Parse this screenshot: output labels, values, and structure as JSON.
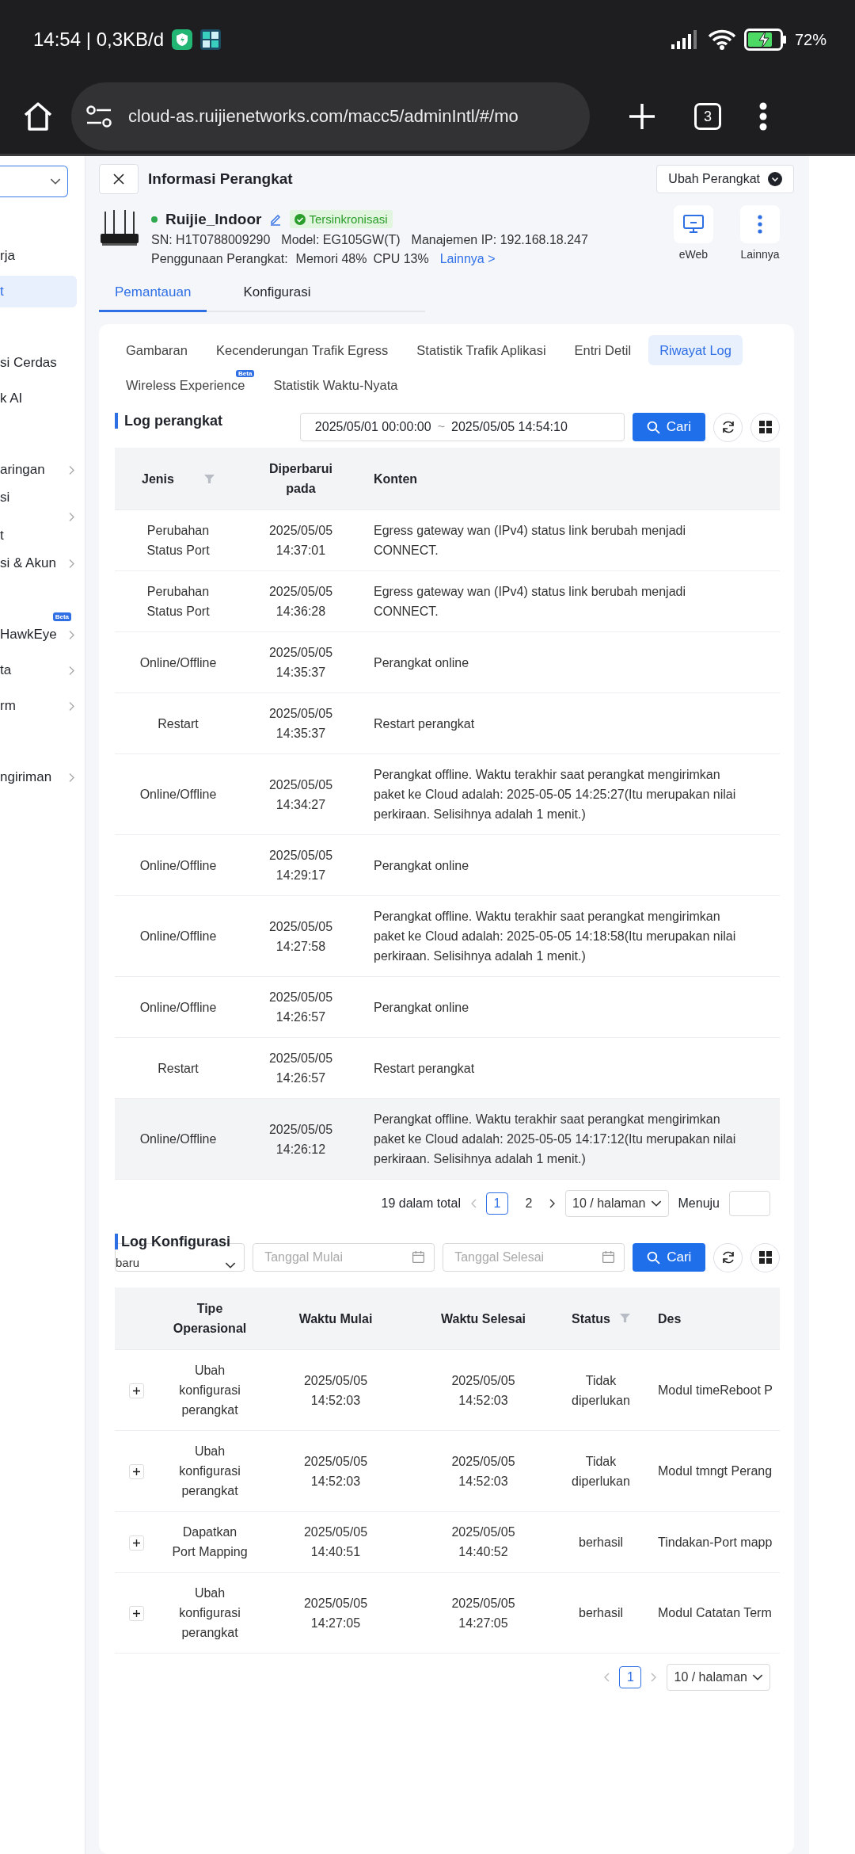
{
  "status_bar": {
    "time_speed": "14:54 | 0,3KB/d",
    "battery": "72%"
  },
  "browser": {
    "url": "cloud-as.ruijienetworks.com/macc5/adminIntl/#/mo",
    "tab_count": "3"
  },
  "sidebar": {
    "groups": [
      [
        {
          "lines": [
            "rja"
          ],
          "selected": false,
          "expandable": false
        },
        {
          "lines": [
            "t"
          ],
          "selected": true,
          "expandable": false
        }
      ],
      [
        {
          "lines": [
            "si Cerdas"
          ],
          "selected": false,
          "expandable": false
        },
        {
          "lines": [
            "k AI"
          ],
          "selected": false,
          "expandable": false
        }
      ],
      [
        {
          "lines": [
            "aringan"
          ],
          "selected": false,
          "expandable": true
        },
        {
          "lines": [
            "si",
            "t"
          ],
          "selected": false,
          "expandable": true
        },
        {
          "lines": [
            "si & Akun"
          ],
          "selected": false,
          "expandable": true
        }
      ],
      [
        {
          "lines": [
            "HawkEye"
          ],
          "selected": false,
          "expandable": true,
          "badge": "Beta"
        },
        {
          "lines": [
            "ta"
          ],
          "selected": false,
          "expandable": true
        },
        {
          "lines": [
            "rm"
          ],
          "selected": false,
          "expandable": true
        }
      ],
      [
        {
          "lines": [
            "ngiriman"
          ],
          "selected": false,
          "expandable": true
        }
      ]
    ]
  },
  "header": {
    "title": "Informasi Perangkat",
    "switch_button": "Ubah Perangkat"
  },
  "device": {
    "name": "Ruijie_Indoor",
    "online": true,
    "sync_badge": "Tersinkronisasi",
    "sn": "SN: H1T0788009290",
    "model": "Model: EG105GW(T)",
    "ip": "Manajemen IP: 192.168.18.247",
    "usage_label": "Penggunaan Perangkat:",
    "memory": "Memori 48%",
    "cpu": "CPU 13%",
    "more_link": "Lainnya >"
  },
  "actions": [
    {
      "kind": "monitor",
      "label": "eWeb"
    },
    {
      "kind": "more",
      "label": "Lainnya"
    }
  ],
  "tabs": [
    {
      "label": "Pemantauan",
      "selected": true
    },
    {
      "label": "Konfigurasi",
      "selected": false
    }
  ],
  "subtabs": [
    {
      "label": "Gambaran",
      "selected": false
    },
    {
      "label": "Kecenderungan Trafik Egress",
      "selected": false
    },
    {
      "label": "Statistik Trafik Aplikasi",
      "selected": false
    },
    {
      "label": "Entri Detil",
      "selected": false
    },
    {
      "label": "Riwayat Log",
      "selected": true
    },
    {
      "label": "Wireless Experience",
      "selected": false,
      "badge": "Beta"
    },
    {
      "label": "Statistik Waktu-Nyata",
      "selected": false
    }
  ],
  "device_log": {
    "title": "Log perangkat",
    "date_start": "2025/05/01 00:00:00",
    "separator": "~",
    "date_end": "2025/05/05 14:54:10",
    "search_button": "Cari",
    "columns": [
      {
        "label": "Jenis",
        "filter": true
      },
      {
        "label": "Diperbarui pada",
        "filter": false
      },
      {
        "label": "Konten",
        "filter": false
      }
    ],
    "rows": [
      {
        "type": "Perubahan Status Port",
        "date": "2025/05/05",
        "time": "14:37:01",
        "content": "Egress gateway wan (IPv4) status link berubah menjadi CONNECT.",
        "highlighted": false
      },
      {
        "type": "Perubahan Status Port",
        "date": "2025/05/05",
        "time": "14:36:28",
        "content": "Egress gateway wan (IPv4) status link berubah menjadi CONNECT.",
        "highlighted": false
      },
      {
        "type": "Online/Offline",
        "date": "2025/05/05",
        "time": "14:35:37",
        "content": "Perangkat online",
        "highlighted": false
      },
      {
        "type": "Restart",
        "date": "2025/05/05",
        "time": "14:35:37",
        "content": "Restart perangkat",
        "highlighted": false
      },
      {
        "type": "Online/Offline",
        "date": "2025/05/05",
        "time": "14:34:27",
        "content": "Perangkat offline. Waktu terakhir saat perangkat mengirimkan paket ke Cloud adalah: 2025-05-05 14:25:27(Itu merupakan nilai perkiraan. Selisihnya adalah 1 menit.)",
        "highlighted": false
      },
      {
        "type": "Online/Offline",
        "date": "2025/05/05",
        "time": "14:29:17",
        "content": "Perangkat online",
        "highlighted": false
      },
      {
        "type": "Online/Offline",
        "date": "2025/05/05",
        "time": "14:27:58",
        "content": "Perangkat offline. Waktu terakhir saat perangkat mengirimkan paket ke Cloud adalah: 2025-05-05 14:18:58(Itu merupakan nilai perkiraan. Selisihnya adalah 1 menit.)",
        "highlighted": false
      },
      {
        "type": "Online/Offline",
        "date": "2025/05/05",
        "time": "14:26:57",
        "content": "Perangkat online",
        "highlighted": false
      },
      {
        "type": "Restart",
        "date": "2025/05/05",
        "time": "14:26:57",
        "content": "Restart perangkat",
        "highlighted": false
      },
      {
        "type": "Online/Offline",
        "date": "2025/05/05",
        "time": "14:26:12",
        "content": "Perangkat offline. Waktu terakhir saat perangkat mengirimkan paket ke Cloud adalah: 2025-05-05 14:17:12(Itu merupakan nilai perkiraan. Selisihnya adalah 1 menit.)",
        "highlighted": true
      }
    ],
    "pagination": {
      "total": "19 dalam total",
      "pages": [
        {
          "label": "1",
          "selected": true
        },
        {
          "label": "2",
          "selected": false
        }
      ],
      "page_size": "10 / halaman",
      "goto_label": "Menuju"
    }
  },
  "config_log": {
    "title": "Log Konfigurasi",
    "filter_value": "baru",
    "start_placeholder": "Tanggal Mulai",
    "end_placeholder": "Tanggal Selesai",
    "search_button": "Cari",
    "columns": [
      {
        "label": "Tipe Operasional",
        "filter": false
      },
      {
        "label": "Waktu Mulai",
        "filter": false
      },
      {
        "label": "Waktu Selesai",
        "filter": false
      },
      {
        "label": "Status",
        "filter": true
      },
      {
        "label": "Des",
        "filter": false
      }
    ],
    "rows": [
      {
        "type": "Ubah konfigurasi perangkat",
        "start_date": "2025/05/05",
        "start_time": "14:52:03",
        "end_date": "2025/05/05",
        "end_time": "14:52:03",
        "status": "Tidak diperlukan",
        "description": "Modul timeReboot P"
      },
      {
        "type": "Ubah konfigurasi perangkat",
        "start_date": "2025/05/05",
        "start_time": "14:52:03",
        "end_date": "2025/05/05",
        "end_time": "14:52:03",
        "status": "Tidak diperlukan",
        "description": "Modul tmngt Perang"
      },
      {
        "type": "Dapatkan Port Mapping",
        "start_date": "2025/05/05",
        "start_time": "14:40:51",
        "end_date": "2025/05/05",
        "end_time": "14:40:52",
        "status": "berhasil",
        "description": "Tindakan-Port mapp"
      },
      {
        "type": "Ubah konfigurasi perangkat",
        "start_date": "2025/05/05",
        "start_time": "14:27:05",
        "end_date": "2025/05/05",
        "end_time": "14:27:05",
        "status": "berhasil",
        "description": "Modul Catatan Term"
      }
    ],
    "pagination": {
      "pages": [
        {
          "label": "1",
          "selected": true
        }
      ],
      "page_size": "10 / halaman"
    }
  }
}
